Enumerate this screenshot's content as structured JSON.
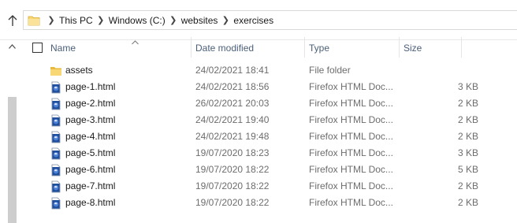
{
  "address_bar": {
    "breadcrumbs": [
      "This PC",
      "Windows (C:)",
      "websites",
      "exercises"
    ],
    "separator": ">"
  },
  "columns": {
    "name": "Name",
    "date_modified": "Date modified",
    "type": "Type",
    "size": "Size",
    "sorted_by": "Name",
    "sort_direction": "ascending"
  },
  "files": [
    {
      "name": "assets",
      "date": "24/02/2021 18:41",
      "type": "File folder",
      "size": "",
      "icon": "folder-icon"
    },
    {
      "name": "page-1.html",
      "date": "24/02/2021 18:56",
      "type": "Firefox HTML Doc...",
      "size": "3 KB",
      "icon": "firefox-html-file-icon"
    },
    {
      "name": "page-2.html",
      "date": "26/02/2021 20:03",
      "type": "Firefox HTML Doc...",
      "size": "2 KB",
      "icon": "firefox-html-file-icon"
    },
    {
      "name": "page-3.html",
      "date": "24/02/2021 19:40",
      "type": "Firefox HTML Doc...",
      "size": "2 KB",
      "icon": "firefox-html-file-icon"
    },
    {
      "name": "page-4.html",
      "date": "24/02/2021 19:48",
      "type": "Firefox HTML Doc...",
      "size": "2 KB",
      "icon": "firefox-html-file-icon"
    },
    {
      "name": "page-5.html",
      "date": "19/07/2020 18:23",
      "type": "Firefox HTML Doc...",
      "size": "3 KB",
      "icon": "firefox-html-file-icon"
    },
    {
      "name": "page-6.html",
      "date": "19/07/2020 18:22",
      "type": "Firefox HTML Doc...",
      "size": "5 KB",
      "icon": "firefox-html-file-icon"
    },
    {
      "name": "page-7.html",
      "date": "19/07/2020 18:22",
      "type": "Firefox HTML Doc...",
      "size": "2 KB",
      "icon": "firefox-html-file-icon"
    },
    {
      "name": "page-8.html",
      "date": "19/07/2020 18:22",
      "type": "Firefox HTML Doc...",
      "size": "2 KB",
      "icon": "firefox-html-file-icon"
    }
  ],
  "colors": {
    "header_text": "#4c607a",
    "folder_yellow": "#f8d775",
    "file_icon_blue": "#1f4e9c",
    "scroll_thumb": "#cdcdcd"
  }
}
